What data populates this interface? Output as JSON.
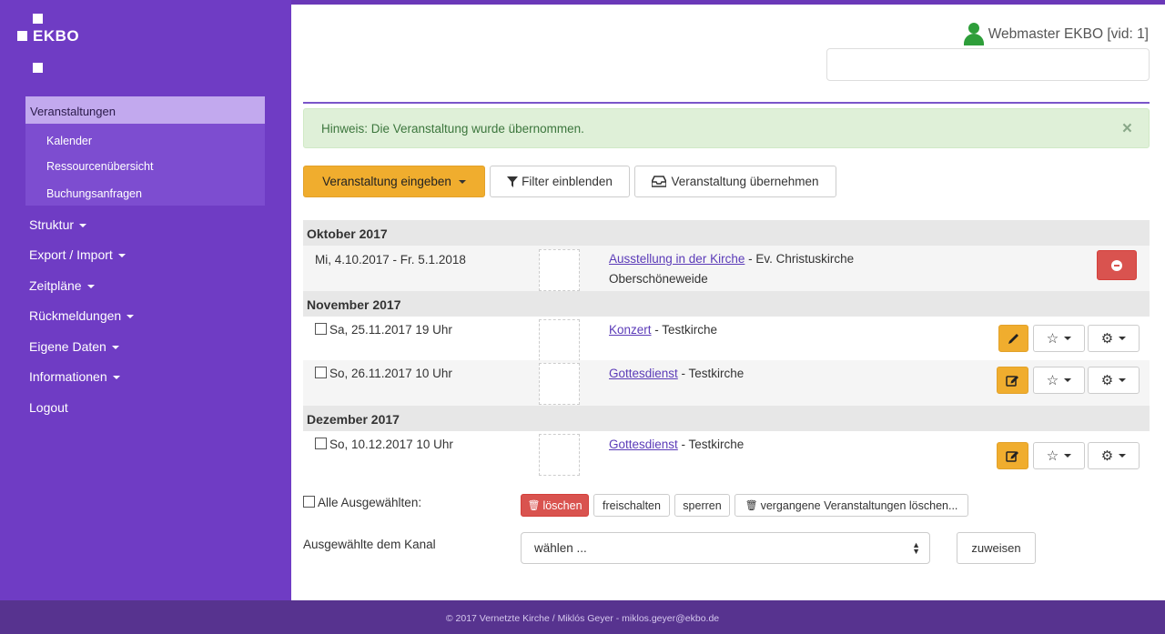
{
  "brand": {
    "name": "EKBO"
  },
  "sidebar": {
    "active": "Veranstaltungen",
    "subitems": [
      "Kalender",
      "Ressourcenübersicht",
      "Buchungsanfragen"
    ],
    "items": [
      "Struktur",
      "Export / Import",
      "Zeitpläne",
      "Rückmeldungen",
      "Eigene Daten",
      "Informationen",
      "Logout"
    ]
  },
  "header": {
    "user": "Webmaster EKBO [vid: 1]",
    "search_placeholder": ""
  },
  "alert": {
    "text": "Hinweis: Die Veranstaltung wurde übernommen.",
    "close": "×"
  },
  "toolbar": {
    "enter_label": "Veranstaltung eingeben",
    "filter_label": "Filter einblenden",
    "take_label": "Veranstaltung übernehmen"
  },
  "sections": [
    {
      "title": "Oktober 2017"
    },
    {
      "title": "November 2017"
    },
    {
      "title": "Dezember 2017"
    }
  ],
  "events": [
    {
      "date": "Mi, 4.10.2017 - Fr. 5.1.2018",
      "title": "Ausstellung in der Kirche",
      "place": " - Ev. Christuskirche",
      "place2": "Oberschöneweide"
    },
    {
      "date": "Sa, 25.11.2017 19 Uhr",
      "title": "Konzert",
      "place": " - Testkirche"
    },
    {
      "date": "So, 26.11.2017 10 Uhr",
      "title": "Gottesdienst",
      "place": " - Testkirche"
    },
    {
      "date": "So, 10.12.2017 10 Uhr",
      "title": "Gottesdienst",
      "place": " - Testkirche"
    }
  ],
  "bulk": {
    "all_label": "Alle Ausgewählten:",
    "delete": "löschen",
    "unlock": "freischalten",
    "lock": "sperren",
    "delete_past": "vergangene Veranstaltungen löschen..."
  },
  "channel": {
    "label": "Ausgewählte dem Kanal",
    "select_value": "wählen ...",
    "assign": "zuweisen"
  },
  "footer": {
    "text": "© 2017 Vernetzte Kirche / Miklós Geyer - miklos.geyer@ekbo.de"
  },
  "colors": {
    "sidebar": "#6f3cc4",
    "accent": "#f0ad2e",
    "success_bg": "#dff0d8",
    "danger": "#d9534f",
    "footer": "#57338f"
  }
}
